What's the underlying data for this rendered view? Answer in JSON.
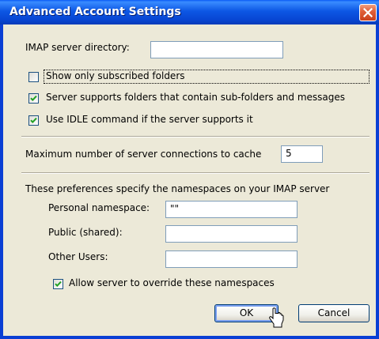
{
  "window": {
    "title": "Advanced Account Settings"
  },
  "imap_directory": {
    "label": "IMAP server directory:",
    "value": ""
  },
  "options": [
    {
      "label": "Show only subscribed folders",
      "checked": false
    },
    {
      "label": "Server supports folders that contain sub-folders and messages",
      "checked": true
    },
    {
      "label": "Use IDLE command if the server supports it",
      "checked": true
    }
  ],
  "connections": {
    "label": "Maximum number of server connections to cache",
    "value": "5"
  },
  "namespaces": {
    "heading": "These preferences specify the namespaces on your IMAP server",
    "personal": {
      "label": "Personal namespace:",
      "value": "\"\""
    },
    "public": {
      "label": "Public (shared):",
      "value": ""
    },
    "other": {
      "label": "Other Users:",
      "value": ""
    },
    "allow_override": {
      "label": "Allow server to override these namespaces",
      "checked": true
    }
  },
  "buttons": {
    "ok": "OK",
    "cancel": "Cancel"
  },
  "colors": {
    "title_bar": "#0a3fd4",
    "dialog_face": "#ece9d8",
    "close_button": "#e0603a",
    "check_mark": "#21a121"
  }
}
